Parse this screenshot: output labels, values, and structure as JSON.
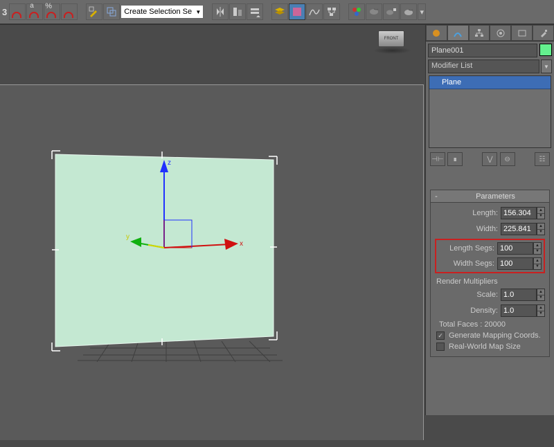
{
  "toolbar": {
    "snap3_label": "3",
    "selection_dropdown": "Create Selection Se"
  },
  "viewcube": {
    "front": "FRONT"
  },
  "gizmo": {
    "x": "x",
    "y": "y",
    "z": "z"
  },
  "panel": {
    "object_name": "Plane001",
    "modifier_list_label": "Modifier List",
    "stack_item": "Plane"
  },
  "parameters": {
    "title": "Parameters",
    "length_label": "Length:",
    "length_value": "156.304",
    "width_label": "Width:",
    "width_value": "225.841",
    "length_segs_label": "Length Segs:",
    "length_segs_value": "100",
    "width_segs_label": "Width Segs:",
    "width_segs_value": "100",
    "render_mult_label": "Render Multipliers",
    "scale_label": "Scale:",
    "scale_value": "1.0",
    "density_label": "Density:",
    "density_value": "1.0",
    "total_faces": "Total Faces : 20000",
    "gen_mapping": "Generate Mapping Coords.",
    "real_world": "Real-World Map Size"
  }
}
